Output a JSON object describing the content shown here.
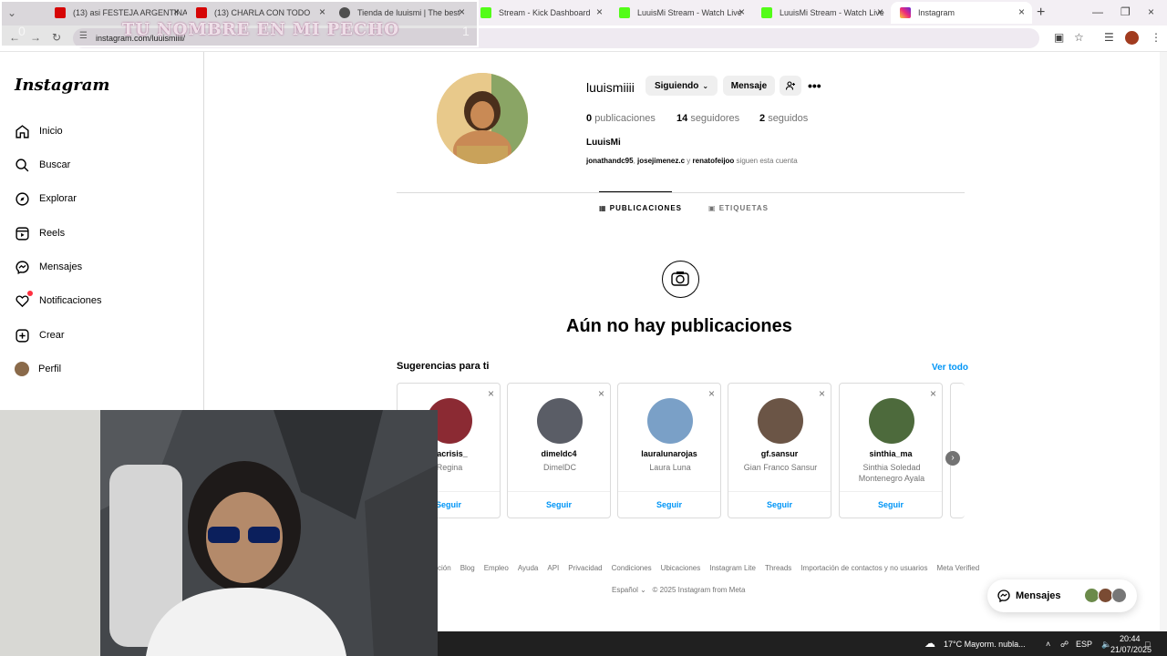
{
  "browser": {
    "tabs": [
      {
        "title": "(13) asi FESTEJA ARGENTINA"
      },
      {
        "title": "(13) CHARLA CON TODO"
      },
      {
        "title": "Tienda de luuismi | The best"
      },
      {
        "title": "Stream - Kick Dashboard"
      },
      {
        "title": "LuuisMi Stream - Watch Live"
      },
      {
        "title": "LuuisMi Stream - Watch Live"
      },
      {
        "title": "Instagram"
      }
    ],
    "url": "instagram.com/luuismiiii/"
  },
  "overlay": {
    "text": "TU NOMBRE EN MI PECHO",
    "left_value": "0",
    "right_value": "1"
  },
  "sidebar": {
    "logo": "Instagram",
    "items": [
      {
        "label": "Inicio"
      },
      {
        "label": "Buscar"
      },
      {
        "label": "Explorar"
      },
      {
        "label": "Reels"
      },
      {
        "label": "Mensajes"
      },
      {
        "label": "Notificaciones"
      },
      {
        "label": "Crear"
      },
      {
        "label": "Perfil"
      }
    ]
  },
  "profile": {
    "username": "luuismiiii",
    "following_button": "Siguiendo",
    "message_button": "Mensaje",
    "posts_count": "0",
    "posts_label": "publicaciones",
    "followers_count": "14",
    "followers_label": "seguidores",
    "following_count": "2",
    "following_label": "seguidos",
    "full_name": "LuuisMi",
    "followed_by_1": "jonathandc95",
    "followed_by_2": "josejimenez.c",
    "followed_by_connector": "y",
    "followed_by_3": "renatofeijoo",
    "followed_by_suffix": "siguen esta cuenta"
  },
  "tabs": {
    "posts": "PUBLICACIONES",
    "tagged": "ETIQUETAS"
  },
  "empty_state": {
    "title": "Aún no hay publicaciones"
  },
  "suggestions": {
    "title": "Sugerencias para ti",
    "see_all": "Ver todo",
    "follow_label": "Seguir",
    "cards": [
      {
        "username": "inacrisis_",
        "name": "Regina",
        "color": "#8b2a33"
      },
      {
        "username": "dimeldc4",
        "name": "DimelDC",
        "color": "#5a5d66"
      },
      {
        "username": "lauralunarojas",
        "name": "Laura Luna",
        "color": "#7aa0c7"
      },
      {
        "username": "gf.sansur",
        "name": "Gian Franco Sansur",
        "color": "#6b5546"
      },
      {
        "username": "sinthia_ma",
        "name": "Sinthia Soledad Montenegro Ayala",
        "color": "#4d6a3c"
      }
    ]
  },
  "footer": {
    "links": [
      "ción",
      "Blog",
      "Empleo",
      "Ayuda",
      "API",
      "Privacidad",
      "Condiciones",
      "Ubicaciones",
      "Instagram Lite",
      "Threads",
      "Importación de contactos y no usuarios",
      "Meta Verified"
    ],
    "language": "Español",
    "copyright": "© 2025 Instagram from Meta"
  },
  "messages_pill": {
    "label": "Mensajes"
  },
  "taskbar": {
    "weather": "17°C  Mayorm. nubla...",
    "lang": "ESP",
    "time": "20:44",
    "date": "21/07/2025"
  }
}
